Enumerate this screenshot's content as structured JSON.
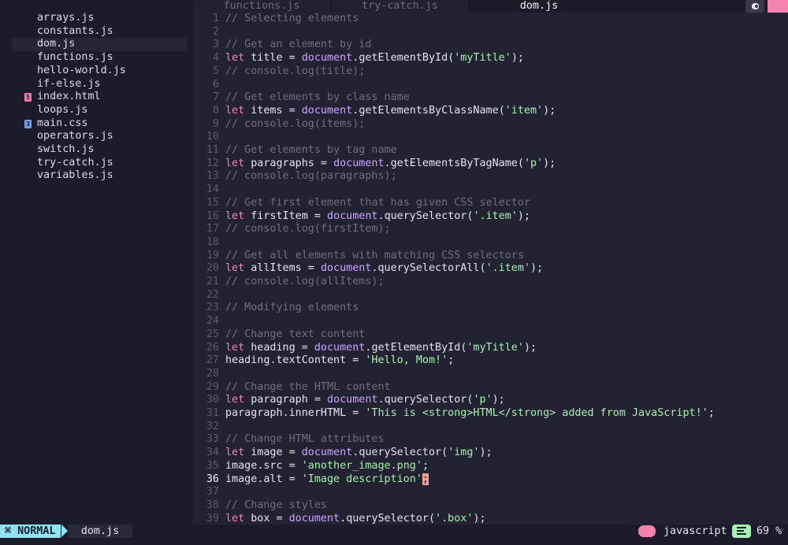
{
  "sidebar": {
    "files": [
      {
        "name": "arrays.js",
        "icon": ""
      },
      {
        "name": "constants.js",
        "icon": ""
      },
      {
        "name": "dom.js",
        "icon": "",
        "active": true
      },
      {
        "name": "functions.js",
        "icon": ""
      },
      {
        "name": "hello-world.js",
        "icon": ""
      },
      {
        "name": "if-else.js",
        "icon": ""
      },
      {
        "name": "index.html",
        "icon": "html5-icon"
      },
      {
        "name": "loops.js",
        "icon": ""
      },
      {
        "name": "main.css",
        "icon": "css3-icon"
      },
      {
        "name": "operators.js",
        "icon": ""
      },
      {
        "name": "switch.js",
        "icon": ""
      },
      {
        "name": "try-catch.js",
        "icon": ""
      },
      {
        "name": "variables.js",
        "icon": ""
      }
    ]
  },
  "tabs": [
    {
      "label": "functions.js"
    },
    {
      "label": "try-catch.js"
    },
    {
      "label": "dom.js",
      "active": true
    }
  ],
  "editor": {
    "current_line": 36,
    "lines": [
      {
        "n": "1",
        "text": "// Selecting elements"
      },
      {
        "n": "2",
        "text": ""
      },
      {
        "n": "3",
        "text": "// Get an element by id"
      },
      {
        "n": "4",
        "text": "let title = document.getElementById('myTitle');"
      },
      {
        "n": "5",
        "text": "// console.log(title);"
      },
      {
        "n": "6",
        "text": ""
      },
      {
        "n": "7",
        "text": "// Get elements by class name"
      },
      {
        "n": "8",
        "text": "let items = document.getElementsByClassName('item');"
      },
      {
        "n": "9",
        "text": "// console.log(items);"
      },
      {
        "n": "10",
        "text": ""
      },
      {
        "n": "11",
        "text": "// Get elements by tag name"
      },
      {
        "n": "12",
        "text": "let paragraphs = document.getElementsByTagName('p');"
      },
      {
        "n": "13",
        "text": "// console.log(paragraphs);"
      },
      {
        "n": "14",
        "text": ""
      },
      {
        "n": "15",
        "text": "// Get first element that has given CSS selector"
      },
      {
        "n": "16",
        "text": "let firstItem = document.querySelector('.item');"
      },
      {
        "n": "17",
        "text": "// console.log(firstItem);"
      },
      {
        "n": "18",
        "text": ""
      },
      {
        "n": "19",
        "text": "// Get all elements with matching CSS selectors"
      },
      {
        "n": "20",
        "text": "let allItems = document.querySelectorAll('.item');"
      },
      {
        "n": "21",
        "text": "// console.log(allItems);"
      },
      {
        "n": "22",
        "text": ""
      },
      {
        "n": "23",
        "text": "// Modifying elements"
      },
      {
        "n": "24",
        "text": ""
      },
      {
        "n": "25",
        "text": "// Change text content"
      },
      {
        "n": "26",
        "text": "let heading = document.getElementById('myTitle');"
      },
      {
        "n": "27",
        "text": "heading.textContent = 'Hello, Mom!';"
      },
      {
        "n": "28",
        "text": ""
      },
      {
        "n": "29",
        "text": "// Change the HTML content"
      },
      {
        "n": "30",
        "text": "let paragraph = document.querySelector('p');"
      },
      {
        "n": "31",
        "text": "paragraph.innerHTML = 'This is <strong>HTML</strong> added from JavaScript!';"
      },
      {
        "n": "32",
        "text": ""
      },
      {
        "n": "33",
        "text": "// Change HTML attributes"
      },
      {
        "n": "34",
        "text": "let image = document.querySelector('img');"
      },
      {
        "n": "35",
        "text": "image.src = 'another_image.png';"
      },
      {
        "n": "36",
        "text": "image.alt = 'Image description';"
      },
      {
        "n": "37",
        "text": ""
      },
      {
        "n": "38",
        "text": "// Change styles"
      },
      {
        "n": "39",
        "text": "let box = document.querySelector('.box');"
      }
    ]
  },
  "statusbar": {
    "mode": "NORMAL",
    "mode_icon": "vim-icon",
    "file": "dom.js",
    "filetype": "javascript",
    "percent": "69 %",
    "progress_icon": "document-lines-icon"
  },
  "colors": {
    "background": "#1c1b29",
    "editor_bg": "#232233",
    "keyword": "#f583ad",
    "string": "#a6f0b0",
    "object": "#c8a6ff",
    "comment": "#6f6e84",
    "mode_bg": "#8fe3f5",
    "cursor": "#f0a090"
  }
}
